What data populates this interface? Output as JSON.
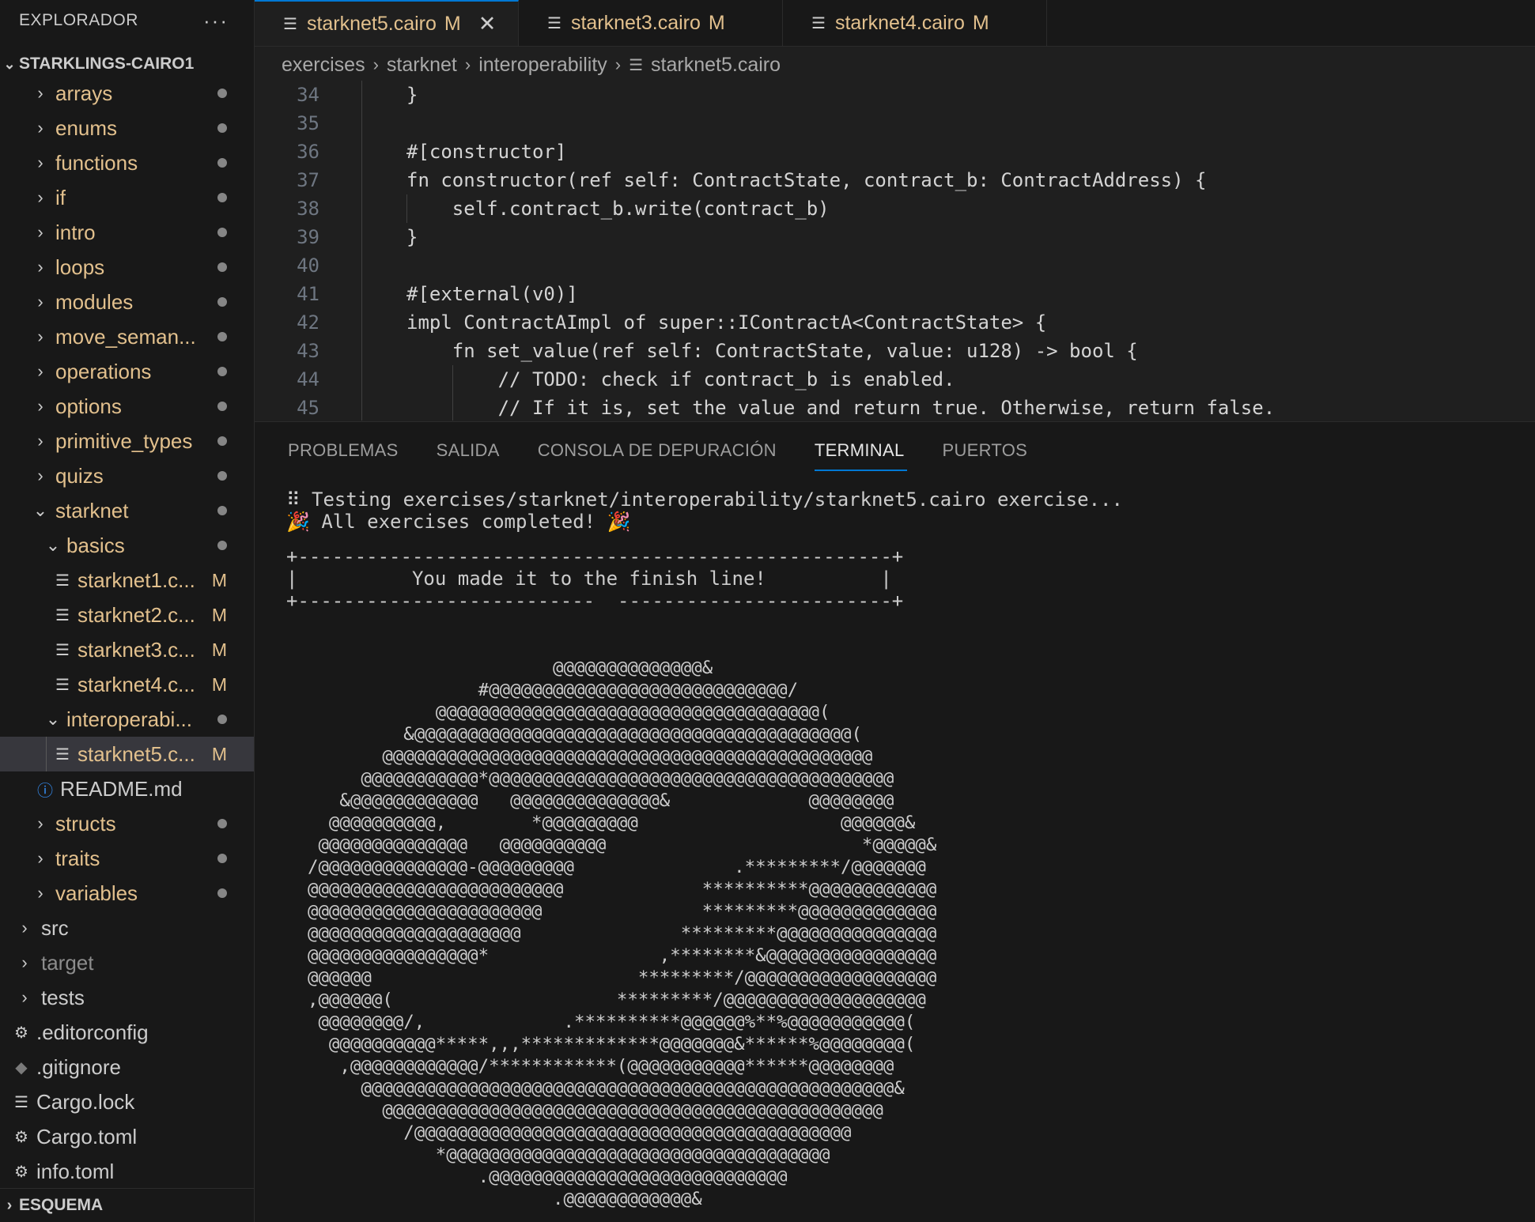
{
  "sidebar": {
    "title": "EXPLORADOR",
    "more": "···",
    "project": "STARKLINGS-CAIRO1",
    "items": [
      {
        "label": "arrays"
      },
      {
        "label": "enums"
      },
      {
        "label": "functions"
      },
      {
        "label": "if"
      },
      {
        "label": "intro"
      },
      {
        "label": "loops"
      },
      {
        "label": "modules"
      },
      {
        "label": "move_seman..."
      },
      {
        "label": "operations"
      },
      {
        "label": "options"
      },
      {
        "label": "primitive_types"
      },
      {
        "label": "quizs"
      },
      {
        "label": "starknet"
      },
      {
        "label": "basics"
      },
      {
        "label": "starknet1.c...",
        "badge": "M"
      },
      {
        "label": "starknet2.c...",
        "badge": "M"
      },
      {
        "label": "starknet3.c...",
        "badge": "M"
      },
      {
        "label": "starknet4.c...",
        "badge": "M"
      },
      {
        "label": "interoperabi..."
      },
      {
        "label": "starknet5.c...",
        "badge": "M"
      },
      {
        "label": "README.md"
      },
      {
        "label": "structs"
      },
      {
        "label": "traits"
      },
      {
        "label": "variables"
      },
      {
        "label": "src"
      },
      {
        "label": "target"
      },
      {
        "label": "tests"
      },
      {
        "label": ".editorconfig"
      },
      {
        "label": ".gitignore"
      },
      {
        "label": "Cargo.lock"
      },
      {
        "label": "Cargo.toml"
      },
      {
        "label": "info.toml"
      }
    ],
    "outline": "ESQUEMA"
  },
  "tabs": [
    {
      "label": "starknet5.cairo",
      "badge": "M",
      "close": "✕"
    },
    {
      "label": "starknet3.cairo",
      "badge": "M"
    },
    {
      "label": "starknet4.cairo",
      "badge": "M"
    }
  ],
  "breadcrumb": [
    "exercises",
    "starknet",
    "interoperability",
    "starknet5.cairo"
  ],
  "editor": {
    "lines": [
      {
        "num": "34",
        "code": "}"
      },
      {
        "num": "35",
        "code": ""
      },
      {
        "num": "36",
        "code": "#[constructor]"
      },
      {
        "num": "37",
        "code": "fn constructor(ref self: ContractState, contract_b: ContractAddress) {"
      },
      {
        "num": "38",
        "code": "    self.contract_b.write(contract_b)"
      },
      {
        "num": "39",
        "code": "}"
      },
      {
        "num": "40",
        "code": ""
      },
      {
        "num": "41",
        "code": "#[external(v0)]"
      },
      {
        "num": "42",
        "code": "impl ContractAImpl of super::IContractA<ContractState> {"
      },
      {
        "num": "43",
        "code": "    fn set_value(ref self: ContractState, value: u128) -> bool {"
      },
      {
        "num": "44",
        "code": "        // TODO: check if contract_b is enabled."
      },
      {
        "num": "45",
        "code": "        // If it is, set the value and return true. Otherwise, return false."
      }
    ]
  },
  "panel": {
    "tabs": [
      "PROBLEMAS",
      "SALIDA",
      "CONSOLA DE DEPURACIÓN",
      "TERMINAL",
      "PUERTOS"
    ],
    "active_tab": "TERMINAL",
    "terminal": {
      "line1": "⠿ Testing exercises/starknet/interoperability/starknet5.cairo exercise...",
      "line2": "🎉 All exercises completed! 🎉",
      "box_top": "+----------------------------------------------------+",
      "box_mid": "|          You made it to the finish line!          |",
      "box_bot": "+--------------------------  ------------------------+",
      "ascii_art": "                         @@@@@@@@@@@@@@&\n                  #@@@@@@@@@@@@@@@@@@@@@@@@@@@@/\n              @@@@@@@@@@@@@@@@@@@@@@@@@@@@@@@@@@@@(\n           &@@@@@@@@@@@@@@@@@@@@@@@@@@@@@@@@@@@@@@@@@(\n         @@@@@@@@@@@@@@@@@@@@@@@@@@@@@@@@@@@@@@@@@@@@@@\n       @@@@@@@@@@@*@@@@@@@@@@@@@@@@@@@@@@@@@@@@@@@@@@@@@@\n     &@@@@@@@@@@@@   @@@@@@@@@@@@@@&             @@@@@@@@\n    @@@@@@@@@@,        *@@@@@@@@@                   @@@@@@&\n   @@@@@@@@@@@@@@   @@@@@@@@@@                        *@@@@@&\n  /@@@@@@@@@@@@@@-@@@@@@@@@               .*********/@@@@@@@\n  @@@@@@@@@@@@@@@@@@@@@@@@             **********@@@@@@@@@@@@\n  @@@@@@@@@@@@@@@@@@@@@@               *********@@@@@@@@@@@@@\n  @@@@@@@@@@@@@@@@@@@@               *********@@@@@@@@@@@@@@@\n  @@@@@@@@@@@@@@@@*                ,********&@@@@@@@@@@@@@@@@\n  @@@@@@                         *********/@@@@@@@@@@@@@@@@@@\n  ,@@@@@@(                     *********/@@@@@@@@@@@@@@@@@@@\n   @@@@@@@@/,             .**********@@@@@@%**%@@@@@@@@@@@(\n    @@@@@@@@@@*****,,,*************@@@@@@@&******%@@@@@@@@(\n     ,@@@@@@@@@@@@/************(@@@@@@@@@@@******@@@@@@@@\n       @@@@@@@@@@@@@@@@@@@@@@@@@@@@@@@@@@@@@@@@@@@@@@@@@@&\n         @@@@@@@@@@@@@@@@@@@@@@@@@@@@@@@@@@@@@@@@@@@@@@@\n           /@@@@@@@@@@@@@@@@@@@@@@@@@@@@@@@@@@@@@@@@@\n              *@@@@@@@@@@@@@@@@@@@@@@@@@@@@@@@@@@@@\n                  .@@@@@@@@@@@@@@@@@@@@@@@@@@@@\n                         .@@@@@@@@@@@@&"
    }
  },
  "colors": {
    "modified": "#e2c08d",
    "accent": "#0078d4"
  }
}
